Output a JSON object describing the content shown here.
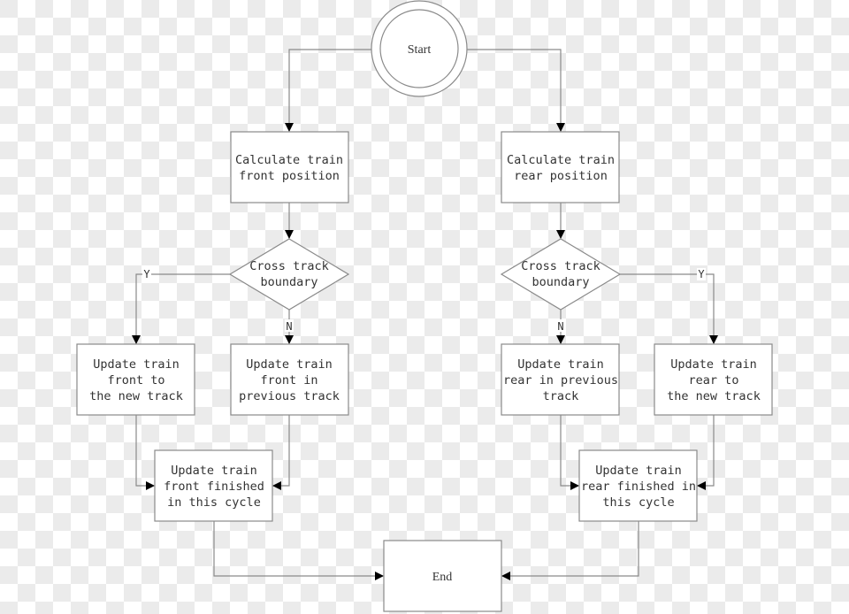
{
  "diagram": {
    "type": "flowchart",
    "nodes": {
      "start": {
        "label": "Start",
        "shape": "double-circle"
      },
      "calc_front": {
        "lines": [
          "Calculate train",
          "front position"
        ],
        "shape": "rectangle"
      },
      "calc_rear": {
        "lines": [
          "Calculate train",
          "rear position"
        ],
        "shape": "rectangle"
      },
      "cross_front": {
        "lines": [
          "Cross track",
          "boundary"
        ],
        "shape": "diamond"
      },
      "cross_rear": {
        "lines": [
          "Cross track",
          "boundary"
        ],
        "shape": "diamond"
      },
      "front_new": {
        "lines": [
          "Update train",
          "front to",
          "the new track"
        ],
        "shape": "rectangle"
      },
      "front_prev": {
        "lines": [
          "Update train",
          "front in",
          "previous track"
        ],
        "shape": "rectangle"
      },
      "rear_prev": {
        "lines": [
          "Update train",
          "rear in previous",
          "track"
        ],
        "shape": "rectangle"
      },
      "rear_new": {
        "lines": [
          "Update train",
          "rear to",
          "the new track"
        ],
        "shape": "rectangle"
      },
      "front_done": {
        "lines": [
          "Update train",
          "front finished",
          "in this cycle"
        ],
        "shape": "rectangle"
      },
      "rear_done": {
        "lines": [
          "Update train",
          "rear finished in",
          "this cycle"
        ],
        "shape": "rectangle"
      },
      "end": {
        "label": "End",
        "shape": "rectangle"
      }
    },
    "edge_labels": {
      "yes": "Y",
      "no": "N"
    },
    "edges": [
      {
        "from": "start",
        "to": "calc_front"
      },
      {
        "from": "start",
        "to": "calc_rear"
      },
      {
        "from": "calc_front",
        "to": "cross_front"
      },
      {
        "from": "calc_rear",
        "to": "cross_rear"
      },
      {
        "from": "cross_front",
        "to": "front_new",
        "label": "Y"
      },
      {
        "from": "cross_front",
        "to": "front_prev",
        "label": "N"
      },
      {
        "from": "cross_rear",
        "to": "rear_prev",
        "label": "N"
      },
      {
        "from": "cross_rear",
        "to": "rear_new",
        "label": "Y"
      },
      {
        "from": "front_new",
        "to": "front_done"
      },
      {
        "from": "front_prev",
        "to": "front_done"
      },
      {
        "from": "rear_prev",
        "to": "rear_done"
      },
      {
        "from": "rear_new",
        "to": "rear_done"
      },
      {
        "from": "front_done",
        "to": "end"
      },
      {
        "from": "rear_done",
        "to": "end"
      }
    ]
  }
}
